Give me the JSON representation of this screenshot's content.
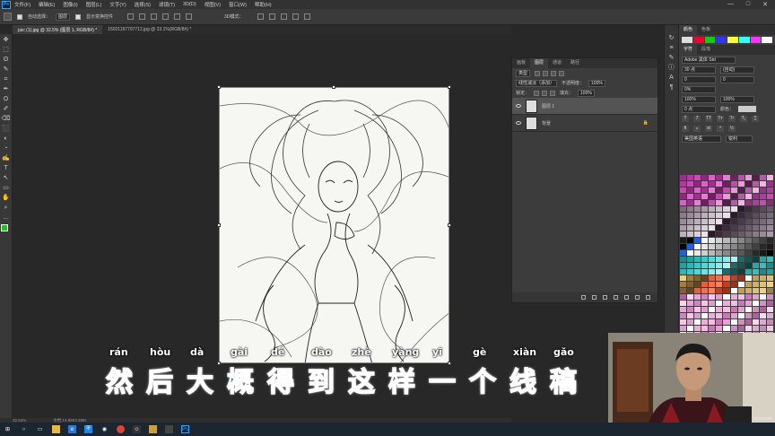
{
  "menubar": {
    "logo": "Ps",
    "items": [
      "文件(F)",
      "编辑(E)",
      "图像(I)",
      "图层(L)",
      "文字(Y)",
      "选择(S)",
      "滤镜(T)",
      "3D(D)",
      "视图(V)",
      "窗口(W)",
      "帮助(H)"
    ],
    "window_controls": [
      "—",
      "□",
      "✕"
    ]
  },
  "optbar": {
    "autoselect": "自动选择：",
    "layer_select": "图层",
    "show_transform": "显示变换控件",
    "mode3d": "3D模式："
  },
  "tabs": [
    {
      "label": "psc (1).jpg @ 32.5% (图层 1, RGB/8#) *"
    },
    {
      "label": "15021197797712.jpg @ 33.1%(RGB/8#) *"
    }
  ],
  "tools": [
    "✥",
    "⬚",
    "ʘ",
    "✎",
    "⌗",
    "✒",
    "⛭",
    "✐",
    "⌫",
    "⬛",
    "◐",
    "◔",
    "✍",
    "T",
    "↖",
    "▭",
    "✋",
    "⌕",
    "…"
  ],
  "layers_panel": {
    "tabs": [
      "图层",
      "通道",
      "路径"
    ],
    "prefix_tabs": [
      "画板"
    ],
    "filter": "类型",
    "blend_mode": "线性减淡（添加）",
    "opacity_label": "不透明度：",
    "opacity": "100%",
    "lock_label": "锁定：",
    "fill_label": "填充：",
    "fill": "100%",
    "layers": [
      {
        "name": "图层 1",
        "selected": true
      },
      {
        "name": "背景",
        "selected": false
      }
    ]
  },
  "char_panel": {
    "tabs": [
      "颜色",
      "色板"
    ],
    "tabs2": [
      "字符",
      "段落"
    ],
    "font": "Adobe 黑体 Std",
    "size": "30 点",
    "leading": "(自动)",
    "tracking": "0",
    "kerning": "0%",
    "vscale": "100%",
    "hscale": "100%",
    "baseline": "0 点",
    "color_label": "颜色：",
    "lang": "美国英语",
    "aa": "锐利"
  },
  "status": {
    "zoom": "32.54%",
    "doc": "文档:14.9M/3.39M"
  },
  "taskbar": {
    "date": "2020/4/29"
  },
  "subtitle": {
    "pinyin": [
      "rán",
      "hòu",
      "dà",
      "gài",
      "dé",
      "dào",
      "zhè",
      "yàng",
      "yī",
      "gè",
      "xiàn",
      "gǎo"
    ],
    "hanzi": [
      "然",
      "后",
      "大",
      "概",
      "得",
      "到",
      "这",
      "样",
      "一",
      "个",
      "线",
      "稿"
    ]
  },
  "colors": {
    "accent": "#31a8ff",
    "subtitle_fill": "#0b3c8a",
    "panel": "#3c3c3c"
  }
}
